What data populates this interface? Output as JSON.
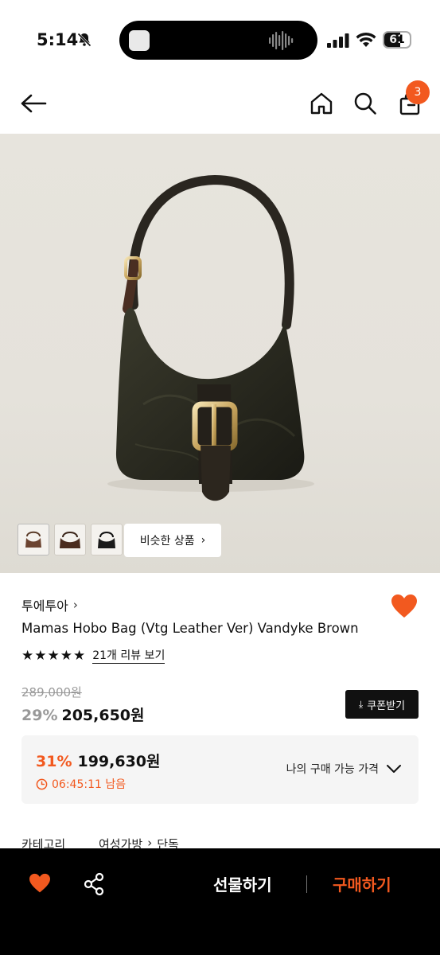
{
  "status_bar": {
    "time": "5:14",
    "battery": "61",
    "icons": [
      "bell-slash-icon",
      "signal-icon",
      "wifi-icon",
      "battery-icon"
    ]
  },
  "header": {
    "icons": [
      "back-arrow-icon",
      "home-icon",
      "search-icon",
      "shopping-bag-icon"
    ],
    "cart_count": "3"
  },
  "gallery": {
    "thumbnails": 3,
    "similar_label": "비슷한 상품"
  },
  "product": {
    "brand": "투에투아",
    "title": "Mamas Hobo Bag (Vtg Leather Ver) Vandyke Brown",
    "stars": "★★★★★",
    "review_link": "21개 리뷰 보기",
    "original_price": "289,000원",
    "discount": "29%",
    "price": "205,650원",
    "coupon_label": "쿠폰받기"
  },
  "my_price": {
    "discount": "31%",
    "price": "199,630원",
    "timer": "06:45:11 남음",
    "label": "나의 구매 가능 가격"
  },
  "category": {
    "label": "카테고리",
    "path": [
      "여성가방",
      "단독"
    ]
  },
  "bottom_bar": {
    "gift_label": "선물하기",
    "buy_label": "구매하기"
  },
  "colors": {
    "accent": "#f2591f",
    "black": "#000000",
    "hero_bg": "#e5e2db"
  }
}
